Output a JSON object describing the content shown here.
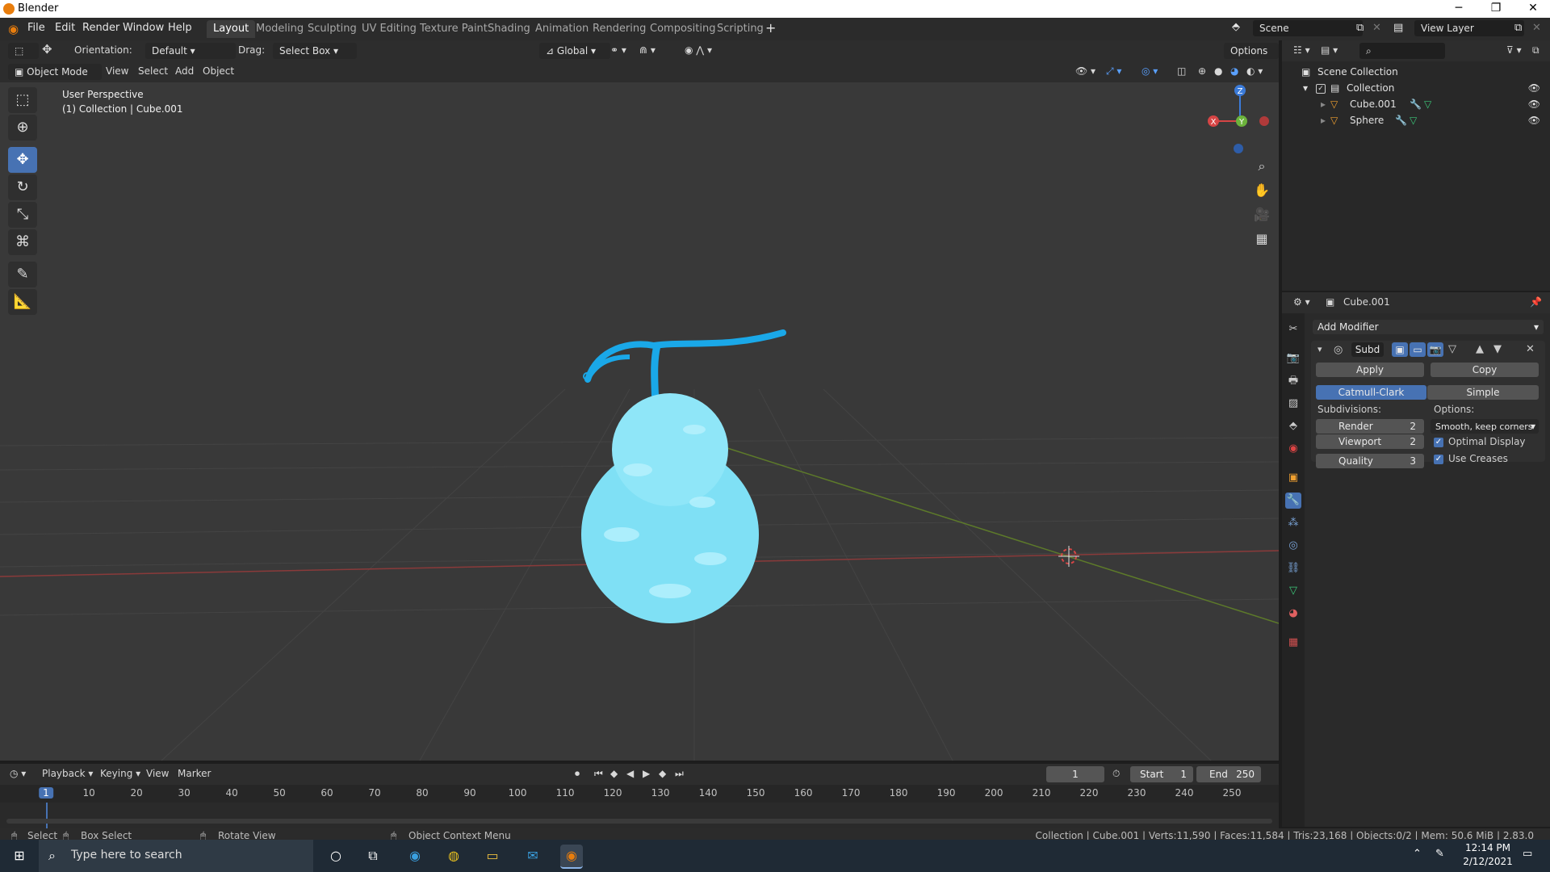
{
  "app": {
    "title": "Blender"
  },
  "menu": [
    "File",
    "Edit",
    "Render",
    "Window",
    "Help"
  ],
  "workspaces": [
    "Layout",
    "Modeling",
    "Sculpting",
    "UV Editing",
    "Texture Paint",
    "Shading",
    "Animation",
    "Rendering",
    "Compositing",
    "Scripting"
  ],
  "active_workspace": "Layout",
  "scene": {
    "name": "Scene",
    "view_layer": "View Layer"
  },
  "viewport_header": {
    "orientation_label": "Orientation:",
    "orientation_value": "Default",
    "drag_label": "Drag:",
    "drag_value": "Select Box",
    "transform_space": "Global",
    "options": "Options",
    "mode": "Object Mode",
    "menus": [
      "View",
      "Select",
      "Add",
      "Object"
    ]
  },
  "viewport": {
    "perspective": "User Perspective",
    "context": "(1) Collection | Cube.001",
    "gizmo": {
      "x": "X",
      "y": "Y",
      "z": "Z"
    }
  },
  "timeline": {
    "menus": [
      "Playback",
      "Keying",
      "View",
      "Marker"
    ],
    "current_frame": "1",
    "start_label": "Start",
    "start": "1",
    "end_label": "End",
    "end": "250",
    "ruler": [
      "1",
      "10",
      "20",
      "30",
      "40",
      "50",
      "60",
      "70",
      "80",
      "90",
      "100",
      "110",
      "120",
      "130",
      "140",
      "150",
      "160",
      "170",
      "180",
      "190",
      "200",
      "210",
      "220",
      "230",
      "240",
      "250"
    ]
  },
  "status": {
    "select": "Select",
    "box_select": "Box Select",
    "rotate": "Rotate View",
    "context_menu": "Object Context Menu",
    "stats": "Collection | Cube.001 | Verts:11,590 | Faces:11,584 | Tris:23,168 | Objects:0/2 | Mem: 50.6 MiB | 2.83.0"
  },
  "outliner": {
    "root": "Scene Collection",
    "collection": "Collection",
    "objects": [
      "Cube.001",
      "Sphere"
    ]
  },
  "properties": {
    "object": "Cube.001",
    "add_modifier": "Add Modifier",
    "modifier_name": "Subd",
    "apply": "Apply",
    "copy": "Copy",
    "catmull": "Catmull-Clark",
    "simple": "Simple",
    "subdivisions_label": "Subdivisions:",
    "options_label": "Options:",
    "render_label": "Render",
    "render_value": "2",
    "viewport_label": "Viewport",
    "viewport_value": "2",
    "quality_label": "Quality",
    "quality_value": "3",
    "uv_smooth": "Smooth, keep corners",
    "optimal_display": "Optimal Display",
    "use_creases": "Use Creases"
  },
  "taskbar": {
    "search": "Type here to search",
    "time": "12:14 PM",
    "date": "2/12/2021"
  },
  "colors": {
    "accent": "#4772b3",
    "object": "#7fe0f5",
    "stem": "#1aa8e8",
    "active_tab": "#3d3d3d"
  }
}
